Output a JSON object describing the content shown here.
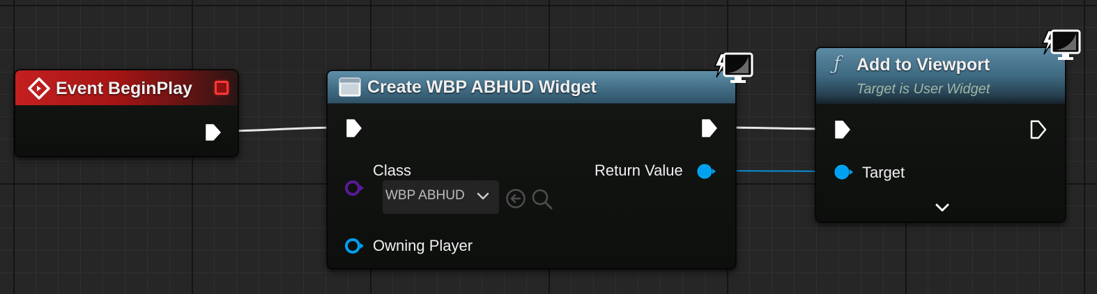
{
  "colors": {
    "grid_background": "#262626",
    "event_header": "#b01818",
    "function_header": "#4a7187",
    "exec_pin": "#ffffff",
    "object_pin": "#00a0f0",
    "class_pin": "#5a1a9a"
  },
  "nodes": {
    "event_begin_play": {
      "title": "Event BeginPlay",
      "icon": "diamond-event-icon",
      "stop_icon": "stop-square-icon"
    },
    "create_widget": {
      "title": "Create WBP ABHUD Widget",
      "icon": "widget-window-icon",
      "badge_icon": "monitor-lightning-icon",
      "class_label": "Class",
      "class_value": "WBP ABHUD",
      "owning_player_label": "Owning Player",
      "return_value_label": "Return Value",
      "use_selected_icon": "arrow-left-circle-icon",
      "browse_icon": "magnifier-icon"
    },
    "add_to_viewport": {
      "title": "Add to Viewport",
      "subtitle": "Target is User Widget",
      "icon": "function-icon",
      "function_glyph": "ƒ",
      "badge_icon": "monitor-lightning-icon",
      "target_label": "Target",
      "expand_icon": "chevron-down-icon"
    }
  }
}
